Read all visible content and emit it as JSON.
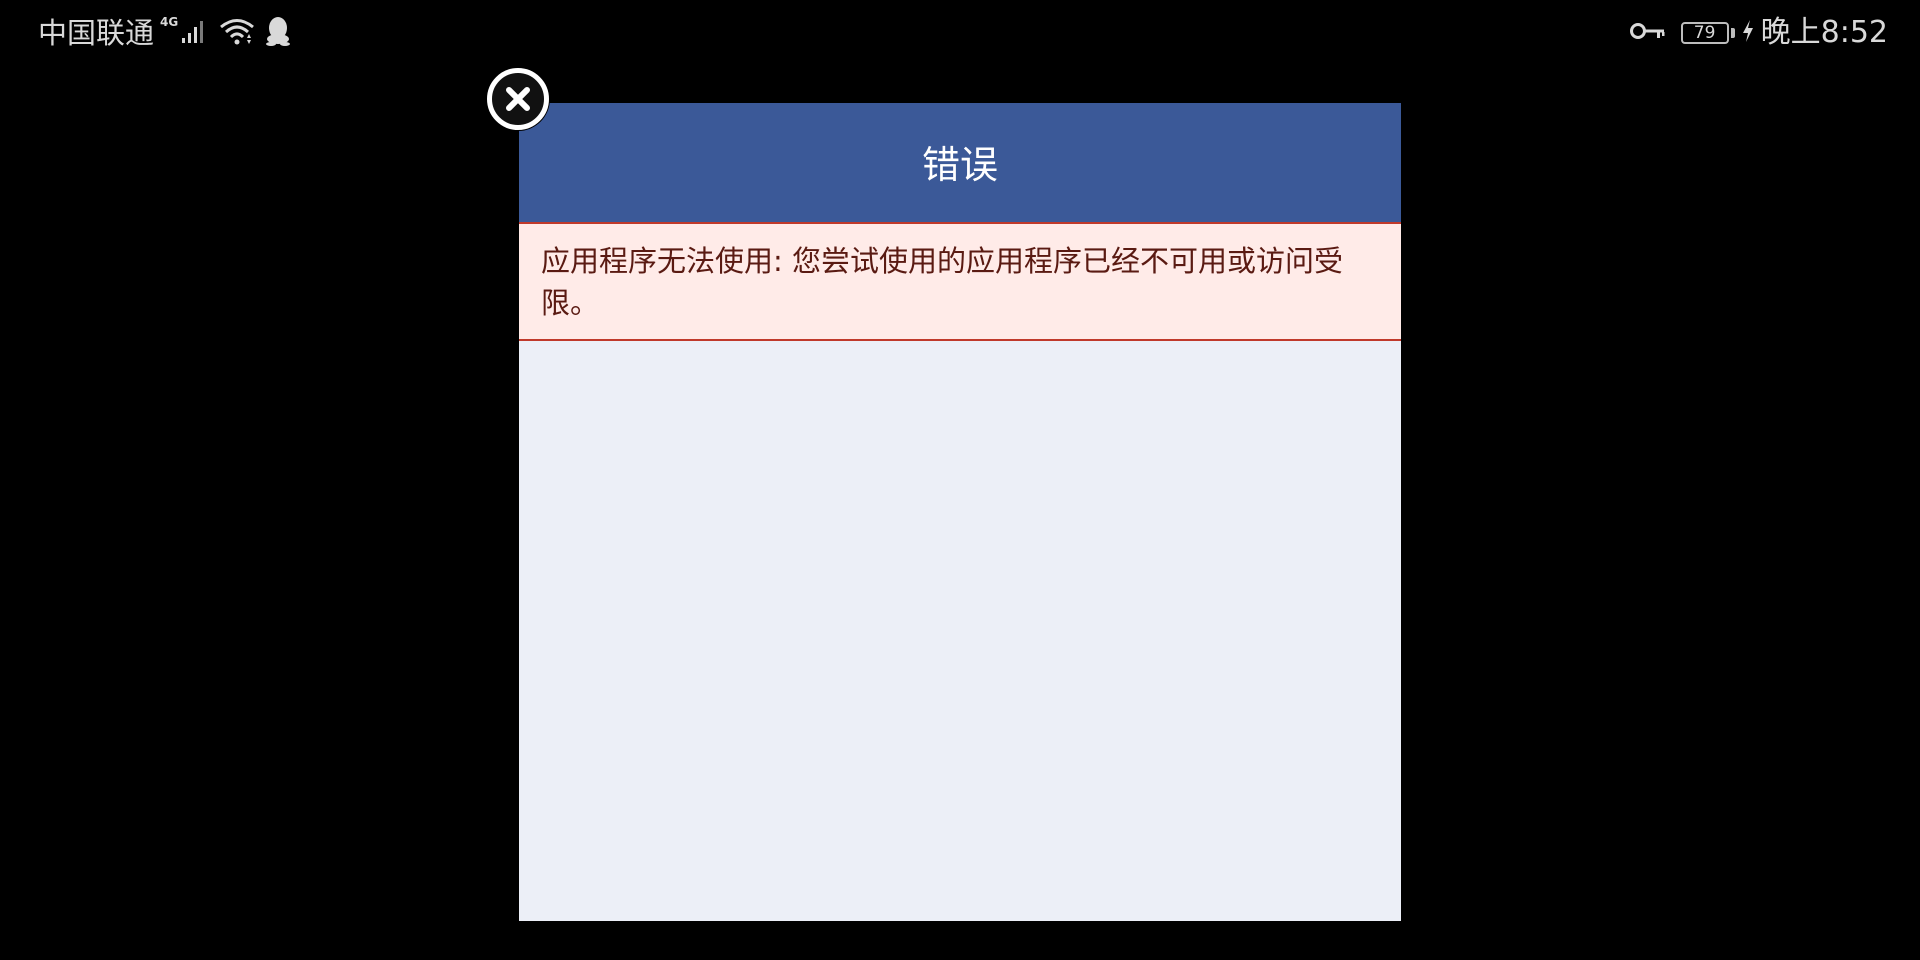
{
  "status_bar": {
    "carrier": "中国联通",
    "network_type": "4G",
    "battery_level": "79",
    "time": "晚上8:52",
    "icons": [
      "signal-icon",
      "wifi-icon",
      "qq-icon",
      "key-icon",
      "battery-icon",
      "charging-icon"
    ]
  },
  "dialog": {
    "title": "错误",
    "error_message": "应用程序无法使用: 您尝试使用的应用程序已经不可用或访问受限。",
    "close_icon": "close-icon"
  },
  "colors": {
    "header": "#3b5998",
    "error_background": "#ffebe8",
    "error_border": "#c0392b",
    "dialog_body": "#eceff7",
    "screen_background": "#000000"
  }
}
